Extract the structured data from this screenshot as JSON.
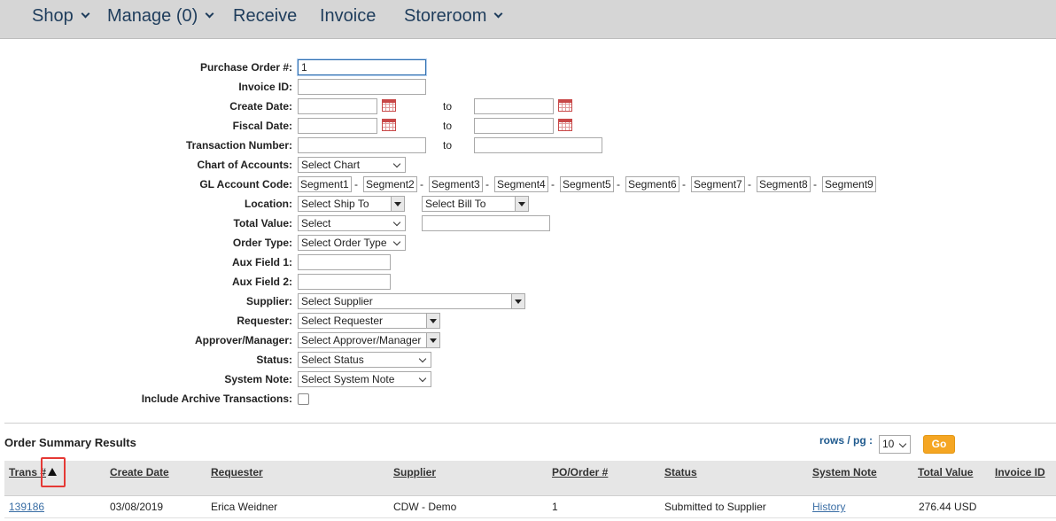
{
  "nav": {
    "shop": "Shop",
    "manage": "Manage (0)",
    "receive": "Receive",
    "invoice": "Invoice",
    "storeroom": "Storeroom"
  },
  "form": {
    "po_label": "Purchase Order #:",
    "po_value": "1",
    "invoice_id_label": "Invoice ID:",
    "create_date_label": "Create Date:",
    "fiscal_date_label": "Fiscal Date:",
    "transaction_number_label": "Transaction Number:",
    "to": "to",
    "chart_label": "Chart of Accounts:",
    "chart_value": "Select Chart",
    "gl_label": "GL Account Code:",
    "segments": [
      "Segment1",
      "Segment2",
      "Segment3",
      "Segment4",
      "Segment5",
      "Segment6",
      "Segment7",
      "Segment8",
      "Segment9"
    ],
    "location_label": "Location:",
    "ship_to": "Select Ship To",
    "bill_to": "Select Bill To",
    "total_value_label": "Total Value:",
    "total_value_select": "Select",
    "order_type_label": "Order Type:",
    "order_type_value": "Select Order Type",
    "aux1_label": "Aux Field 1:",
    "aux2_label": "Aux Field 2:",
    "supplier_label": "Supplier:",
    "supplier_value": "Select Supplier",
    "requester_label": "Requester:",
    "requester_value": "Select Requester",
    "approver_label": "Approver/Manager:",
    "approver_value": "Select Approver/Manager",
    "status_label": "Status:",
    "status_value": "Select Status",
    "system_note_label": "System Note:",
    "system_note_value": "Select System Note",
    "archive_label": "Include Archive Transactions:"
  },
  "results": {
    "title": "Order Summary Results",
    "rows_per_page_label": "rows / pg :",
    "rows_per_page_value": "10",
    "go": "Go",
    "columns": [
      "Trans #",
      "Create Date",
      "Requester",
      "Supplier",
      "PO/Order #",
      "Status",
      "System Note",
      "Total Value",
      "Invoice ID"
    ],
    "rows": [
      {
        "trans": "139186",
        "create_date": "03/08/2019",
        "requester": "Erica Weidner",
        "supplier": "CDW - Demo",
        "po": "1",
        "status": "Submitted to Supplier",
        "system_note": "History",
        "total_value": "276.44 USD",
        "invoice_id": ""
      }
    ]
  },
  "colors": {
    "nav_bg": "#d6d6d6",
    "nav_text": "#1f3d5c",
    "go_button": "#f5a623",
    "highlight_box": "#e53935",
    "link": "#3a6ea5"
  }
}
